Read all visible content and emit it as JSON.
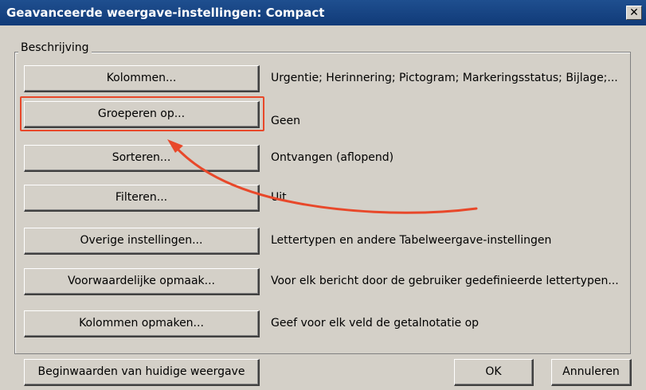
{
  "window": {
    "title": "Geavanceerde weergave-instellingen: Compact",
    "close_glyph": "✕"
  },
  "group": {
    "label": "Beschrijving"
  },
  "rows": [
    {
      "button": "Kolommen...",
      "description": "Urgentie; Herinnering; Pictogram; Markeringsstatus; Bijlage;..."
    },
    {
      "button": "Groeperen op...",
      "description": "Geen"
    },
    {
      "button": "Sorteren...",
      "description": "Ontvangen (aflopend)"
    },
    {
      "button": "Filteren...",
      "description": "Uit"
    },
    {
      "button": "Overige instellingen...",
      "description": "Lettertypen en andere Tabelweergave-instellingen"
    },
    {
      "button": "Voorwaardelijke opmaak...",
      "description": "Voor elk bericht door de gebruiker gedefinieerde lettertypen..."
    },
    {
      "button": "Kolommen opmaken...",
      "description": "Geef voor elk veld de getalnotatie op"
    }
  ],
  "footer": {
    "reset_label": "Beginwaarden van huidige weergave",
    "ok_label": "OK",
    "cancel_label": "Annuleren"
  },
  "annotation": {
    "highlight_color": "#e8482a"
  }
}
